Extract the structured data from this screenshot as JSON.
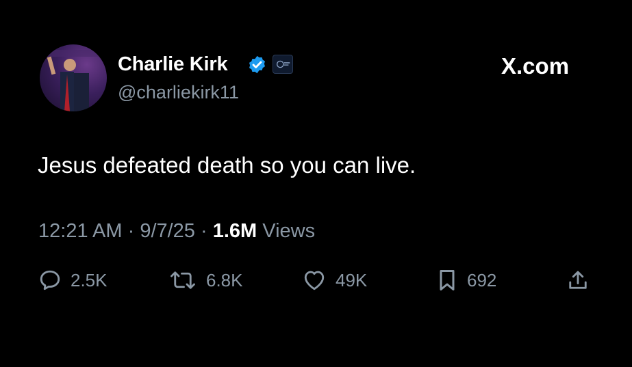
{
  "author": {
    "display_name": "Charlie Kirk",
    "handle": "@charliekirk11",
    "verified": true
  },
  "brand": {
    "text": "X.com"
  },
  "tweet": {
    "text": "Jesus defeated death so you can live.",
    "time": "12:21 AM",
    "date": "9/7/25",
    "views_count": "1.6M",
    "views_label": "Views"
  },
  "actions": {
    "replies": "2.5K",
    "reposts": "6.8K",
    "likes": "49K",
    "bookmarks": "692"
  },
  "colors": {
    "background": "#000000",
    "primary_text": "#ffffff",
    "secondary_text": "#8b98a5",
    "verified_blue": "#1d9bf0"
  },
  "icons": {
    "verified": "verified-badge-icon",
    "reply": "speech-bubble-icon",
    "repost": "repost-arrows-icon",
    "like": "heart-icon",
    "bookmark": "bookmark-icon",
    "share": "share-upload-icon"
  }
}
